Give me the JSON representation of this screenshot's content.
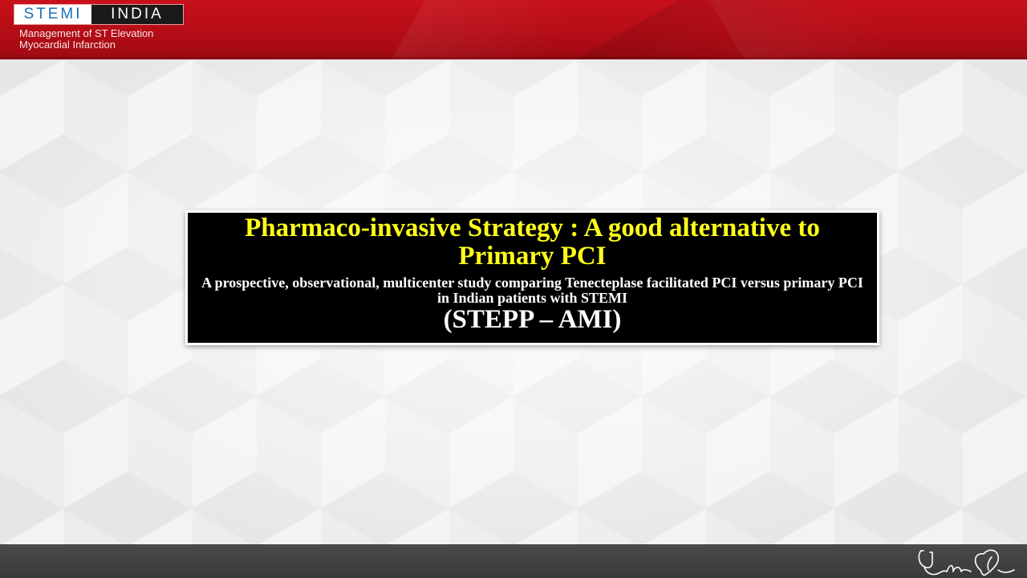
{
  "header": {
    "logo_left": "STEMI",
    "logo_right": "INDIA",
    "tagline_line1": "Management of ST Elevation",
    "tagline_line2": "Myocardial Infarction"
  },
  "title_box": {
    "main": "Pharmaco-invasive Strategy : A  good alternative to Primary PCI",
    "sub": "A prospective, observational, multicenter study comparing  Tenecteplase facilitated PCI versus primary PCI in Indian patients with STEMI",
    "acronym": "(STEPP – AMI)"
  },
  "footer": {
    "icon": "stethoscope-heart-icon"
  },
  "colors": {
    "header_red": "#c8101a",
    "title_yellow": "#ffff1a",
    "title_box_bg": "#000000",
    "footer_gray": "#3f3f3f",
    "logo_blue": "#1e6fb4"
  }
}
